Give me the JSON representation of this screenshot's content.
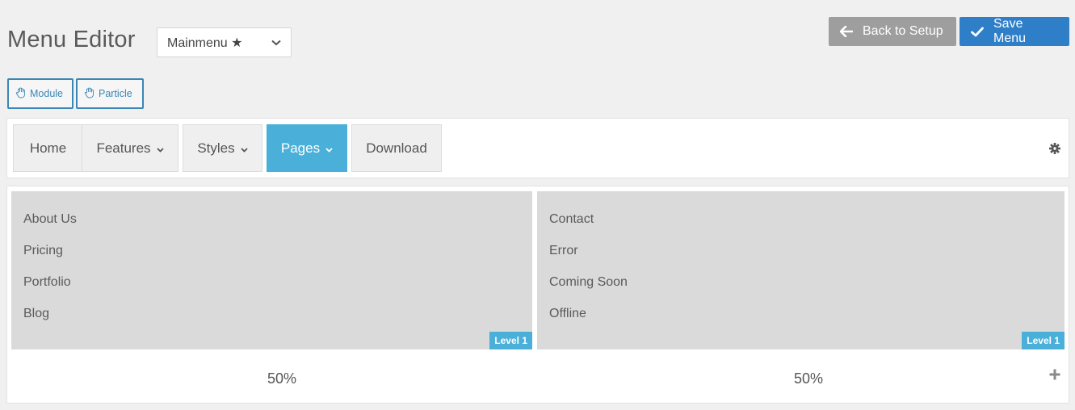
{
  "header": {
    "title": "Menu Editor",
    "menu_select": {
      "value": "Mainmenu ★",
      "icon": "chevron-down-icon"
    },
    "back_button": {
      "label": "Back to Setup",
      "icon": "arrow-left-icon"
    },
    "save_button": {
      "label": "Save Menu",
      "icon": "check-icon"
    }
  },
  "toolbar": {
    "chips": [
      {
        "label": "Module",
        "icon": "hand-icon"
      },
      {
        "label": "Particle",
        "icon": "hand-icon"
      }
    ]
  },
  "nav": {
    "items": [
      {
        "label": "Home",
        "has_dropdown": false,
        "active": false
      },
      {
        "label": "Features",
        "has_dropdown": true,
        "active": false
      },
      {
        "label": "Styles",
        "has_dropdown": true,
        "active": false
      },
      {
        "label": "Pages",
        "has_dropdown": true,
        "active": true
      },
      {
        "label": "Download",
        "has_dropdown": false,
        "active": false
      }
    ],
    "settings_icon": "gear-icon"
  },
  "submenu": {
    "columns": [
      {
        "items": [
          "About Us",
          "Pricing",
          "Portfolio",
          "Blog"
        ],
        "level": "Level 1",
        "width_label": "50%"
      },
      {
        "items": [
          "Contact",
          "Error",
          "Coming Soon",
          "Offline"
        ],
        "level": "Level 1",
        "width_label": "50%"
      }
    ],
    "add_icon": "plus-icon"
  },
  "colors": {
    "accent": "#4ab0d9",
    "save": "#2f7fc8",
    "back": "#9e9e9e",
    "chip_border": "#3a87b5"
  }
}
